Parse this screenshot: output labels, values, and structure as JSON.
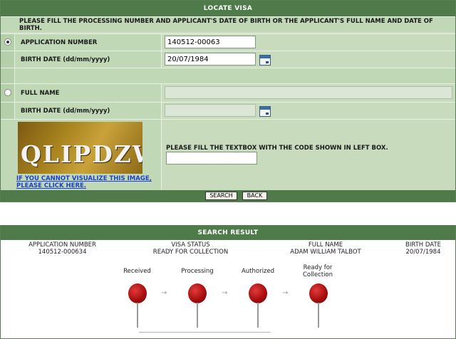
{
  "locate": {
    "title": "LOCATE VISA",
    "instructions": "PLEASE FILL THE PROCESSING NUMBER AND APPLICANT'S DATE OF BIRTH OR THE APPLICANT'S FULL NAME AND DATE OF BIRTH.",
    "application_number_label": "APPLICATION NUMBER",
    "application_number_value": "140512-00063",
    "birth_date_label": "BIRTH DATE (dd/mm/yyyy)",
    "birth_date_value": "20/07/1984",
    "full_name_label": "FULL NAME",
    "full_name_value": "",
    "birth_date2_label": "BIRTH DATE (dd/mm/yyyy)",
    "birth_date2_value": "",
    "captcha_text": "QLIPDZW",
    "captcha_link": "IF YOU CANNOT VISUALIZE THIS IMAGE, PLEASE CLICK HERE.",
    "captcha_instruction": "PLEASE FILL THE TEXTBOX WITH THE CODE SHOWN IN LEFT BOX.",
    "captcha_input_value": "",
    "search_label": "SEARCH",
    "back_label": "BACK",
    "selected_option": "application-number"
  },
  "result": {
    "title": "SEARCH RESULT",
    "application_number_label": "APPLICATION NUMBER",
    "application_number_value": "140512-000634",
    "visa_status_label": "VISA STATUS",
    "visa_status_value": "READY FOR COLLECTION",
    "full_name_label": "FULL NAME",
    "full_name_value": "ADAM WILLIAM TALBOT",
    "birth_date_label": "BIRTH DATE",
    "birth_date_value": "20/07/1984",
    "stages": [
      "Received",
      "Processing",
      "Authorized",
      "Ready for Collection"
    ],
    "arrow_glyph": "→"
  },
  "colors": {
    "header": "#4f7a4a",
    "panel": "#cfe0c7",
    "pin": "#a80f0f",
    "link": "#1b3fd1"
  }
}
